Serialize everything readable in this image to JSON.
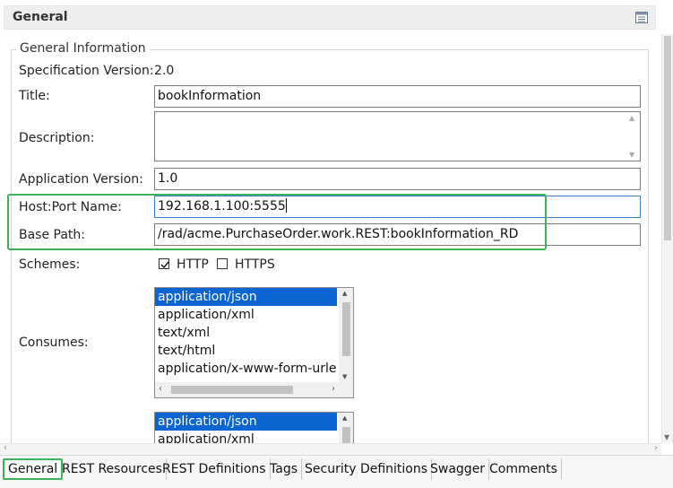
{
  "section": {
    "title": "General",
    "icon": "panel-list-icon"
  },
  "group": {
    "legend": "General Information"
  },
  "form": {
    "spec_version_label": "Specification Version:",
    "spec_version_value": "2.0",
    "title_label": "Title:",
    "title_value": "bookInformation",
    "description_label": "Description:",
    "description_value": "",
    "app_version_label": "Application Version:",
    "app_version_value": "1.0",
    "host_label": "Host:Port Name:",
    "host_value": "192.168.1.100:5555",
    "base_path_label": "Base Path:",
    "base_path_value": "/rad/acme.PurchaseOrder.work.REST:bookInformation_RD",
    "schemes_label": "Schemes:",
    "schemes": [
      {
        "label": "HTTP",
        "checked": true
      },
      {
        "label": "HTTPS",
        "checked": false
      }
    ],
    "consumes_label": "Consumes:",
    "consumes_items": [
      "application/json",
      "application/xml",
      "text/xml",
      "text/html",
      "application/x-www-form-urlencoded"
    ],
    "consumes_selected": "application/json",
    "produces_items": [
      "application/json",
      "application/xml"
    ],
    "produces_selected": "application/json"
  },
  "tabs": [
    "General",
    "REST Resources",
    "REST Definitions",
    "Tags",
    "Security Definitions",
    "Swagger",
    "Comments"
  ],
  "active_tab": "General",
  "colors": {
    "highlight": "#3cb55a",
    "selection": "#0a64d2",
    "focus": "#3b82c4"
  }
}
